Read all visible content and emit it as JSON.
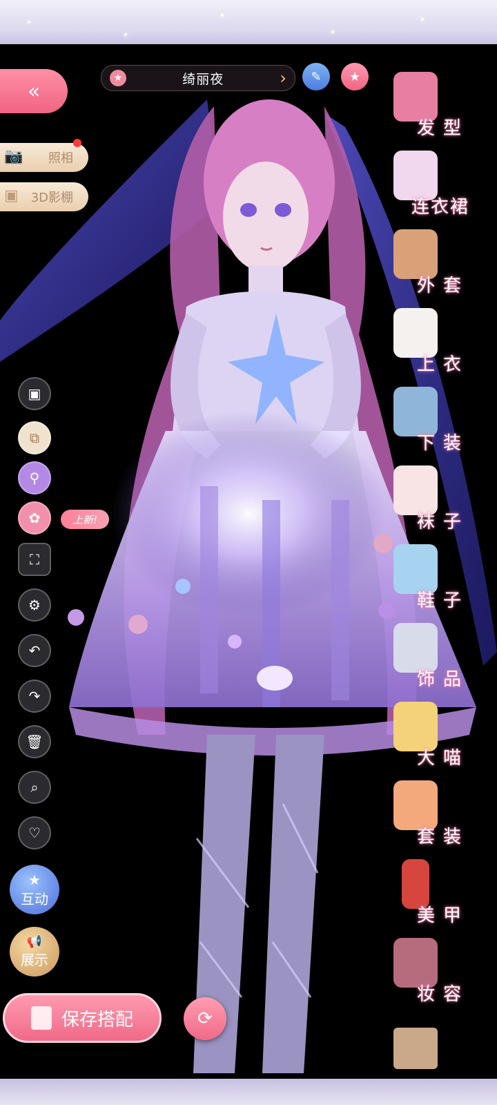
{
  "outfit_name": "绮丽夜",
  "top_bar": {
    "back_icon": "«",
    "edit_icon": "pencil-icon",
    "favorite_icon": "star-icon"
  },
  "side_actions": [
    {
      "label": "照相",
      "icon": "camera-icon",
      "has_notification": true
    },
    {
      "label": "3D影棚",
      "icon": "cube-icon",
      "has_notification": false
    }
  ],
  "tools": [
    {
      "name": "background-icon",
      "glyph": "▣"
    },
    {
      "name": "layers-icon",
      "glyph": "⧉"
    },
    {
      "name": "search-filter-icon",
      "glyph": "⚲"
    },
    {
      "name": "palette-icon",
      "glyph": "🎨"
    },
    {
      "name": "fullscreen-icon",
      "glyph": "⛶"
    },
    {
      "name": "settings-icon",
      "glyph": "⚙"
    },
    {
      "name": "undo-icon",
      "glyph": "↶"
    },
    {
      "name": "redo-icon",
      "glyph": "↷"
    },
    {
      "name": "trash-icon",
      "glyph": "🗑"
    },
    {
      "name": "zoom-icon",
      "glyph": "⌕"
    },
    {
      "name": "heart-icon",
      "glyph": "♡"
    }
  ],
  "new_tag": "上新!",
  "interact_label": "互动",
  "show_label": "展示",
  "save_label": "保存搭配",
  "categories": [
    {
      "label": "发型",
      "color": "#e77fa3"
    },
    {
      "label": "连衣裙",
      "color": "#f1d8ee"
    },
    {
      "label": "外套",
      "color": "#d9a178"
    },
    {
      "label": "上衣",
      "color": "#f5f1ee"
    },
    {
      "label": "下装",
      "color": "#8fb6d9"
    },
    {
      "label": "袜子",
      "color": "#f8e4e4"
    },
    {
      "label": "鞋子",
      "color": "#a7d3f0"
    },
    {
      "label": "饰品",
      "color": "#d8dcea"
    },
    {
      "label": "大喵",
      "color": "#f4d27a"
    },
    {
      "label": "套装",
      "color": "#f3a97b"
    },
    {
      "label": "美甲",
      "color": "#d6463e"
    },
    {
      "label": "妆容",
      "color": "#b76c7e"
    }
  ],
  "colors": {
    "accent_pink": "#f06483",
    "label_glow": "#ff7fb0",
    "pill_cream": "#f8ead7"
  }
}
